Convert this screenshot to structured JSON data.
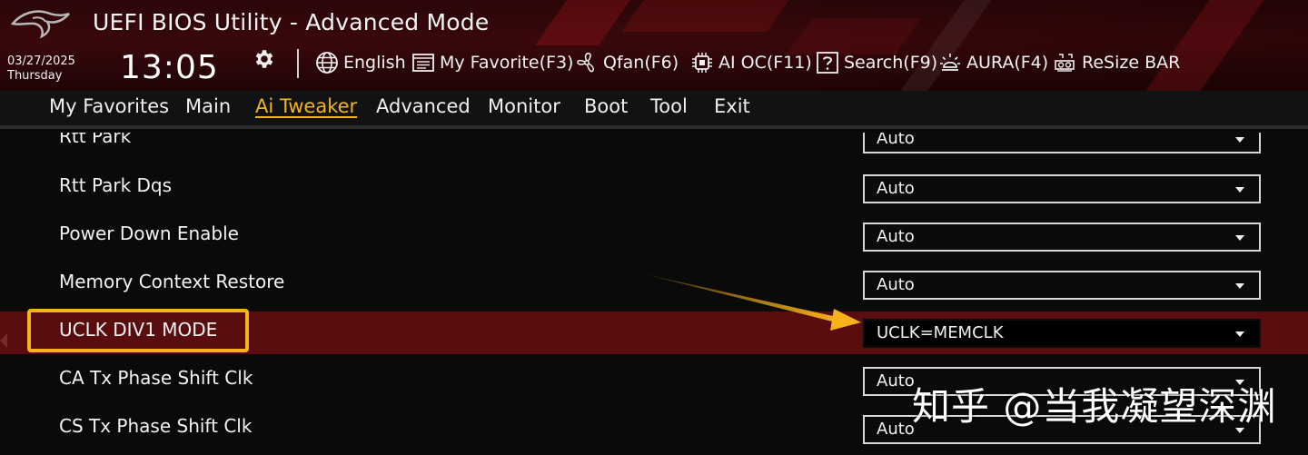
{
  "header": {
    "title": "UEFI BIOS Utility - Advanced Mode",
    "date": "03/27/2025",
    "weekday": "Thursday",
    "time": "13:05"
  },
  "toolbar": [
    {
      "name": "language",
      "label": "English",
      "icon": "globe-icon"
    },
    {
      "name": "my-favorite",
      "label": "My Favorite(F3)",
      "icon": "favorite-list-icon"
    },
    {
      "name": "qfan",
      "label": "Qfan(F6)",
      "icon": "fan-icon"
    },
    {
      "name": "ai-oc",
      "label": "AI OC(F11)",
      "icon": "chip-icon"
    },
    {
      "name": "search",
      "label": "Search(F9)",
      "icon": "question-box-icon"
    },
    {
      "name": "aura",
      "label": "AURA(F4)",
      "icon": "light-icon"
    },
    {
      "name": "resize-bar",
      "label": "ReSize BAR",
      "icon": "gpu-icon"
    }
  ],
  "nav": {
    "tabs": [
      "My Favorites",
      "Main",
      "Ai Tweaker",
      "Advanced",
      "Monitor",
      "Boot",
      "Tool",
      "Exit"
    ],
    "active": "Ai Tweaker"
  },
  "settings": [
    {
      "label": "Rtt Park",
      "value": "Auto"
    },
    {
      "label": "Rtt Park Dqs",
      "value": "Auto"
    },
    {
      "label": "Power Down Enable",
      "value": "Auto"
    },
    {
      "label": "Memory Context Restore",
      "value": "Auto"
    },
    {
      "label": "UCLK DIV1 MODE",
      "value": "UCLK=MEMCLK",
      "selected": true
    },
    {
      "label": "CA Tx Phase Shift Clk",
      "value": "Auto"
    },
    {
      "label": "CS Tx Phase Shift Clk",
      "value": "Auto"
    }
  ],
  "watermark": "知乎 @当我凝望深渊",
  "colors": {
    "accent": "#f1b51c",
    "annotation": "#f7b11a",
    "selected_row": "#5a0d0f",
    "header_red": "#3a080b"
  }
}
